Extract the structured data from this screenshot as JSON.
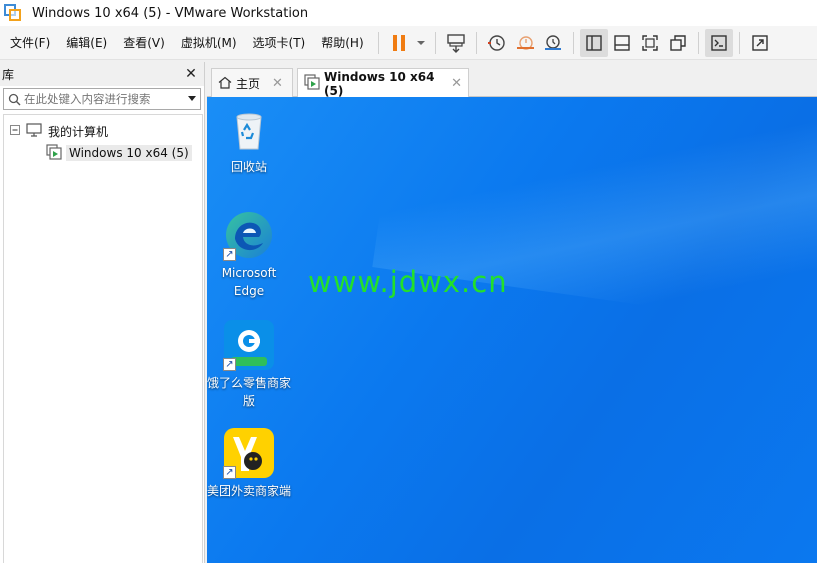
{
  "window": {
    "title": "Windows 10 x64 (5) - VMware Workstation"
  },
  "menu": {
    "items": [
      "文件(F)",
      "编辑(E)",
      "查看(V)",
      "虚拟机(M)",
      "选项卡(T)",
      "帮助(H)"
    ]
  },
  "toolbar": {
    "icons": [
      "pause-icon",
      "dropdown-icon",
      "send-keys-icon",
      "snapshot-icon",
      "revert-snapshot-icon",
      "snapshot-manager-icon",
      "library-view-icon",
      "thumbnail-view-icon",
      "fullscreen-icon",
      "unity-icon",
      "console-icon",
      "stretch-icon"
    ],
    "pause_color": "#f07c12"
  },
  "library": {
    "title": "库",
    "close": "✕",
    "search_placeholder": "在此处键入内容进行搜索",
    "tree": {
      "root_label": "我的计算机",
      "child_label": "Windows 10 x64 (5)"
    }
  },
  "tabs": [
    {
      "label": "主页",
      "close": "✕"
    },
    {
      "label": "Windows 10 x64 (5)",
      "close": "✕"
    }
  ],
  "desktop": {
    "icons": [
      {
        "label": "回收站",
        "icon": "recycle-bin-icon"
      },
      {
        "label": "Microsoft Edge",
        "icon": "edge-icon"
      },
      {
        "label": "饿了么零售商家版",
        "icon": "eleme-retail-icon"
      },
      {
        "label": "美团外卖商家端",
        "icon": "meituan-waimai-icon"
      }
    ],
    "watermark": "www.jdwx.cn",
    "colors": {
      "wallpaper": "#0b79ef",
      "watermark": "#23e02b"
    }
  }
}
